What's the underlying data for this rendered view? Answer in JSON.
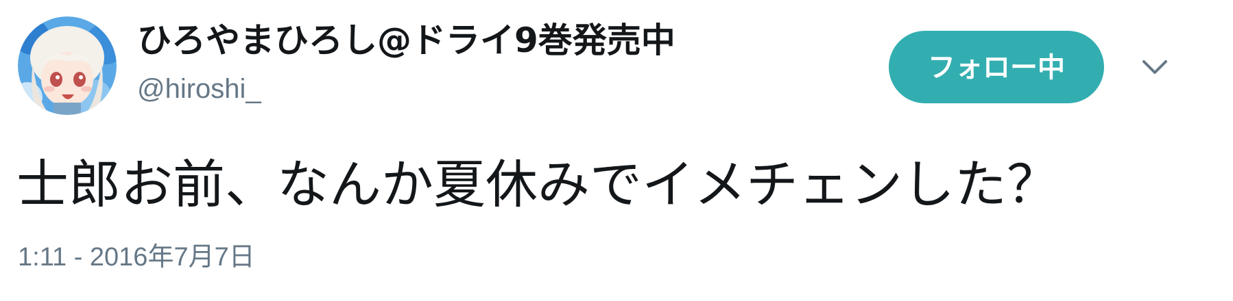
{
  "tweet": {
    "author": {
      "display_name": "ひろやまひろし@ドライ9巻発売中",
      "screen_name": "@hiroshi_",
      "avatar": "anime-character-avatar"
    },
    "follow_button_label": "フォロー中",
    "menu_icon": "chevron-down-icon",
    "text": "士郎お前、なんか夏休みでイメチェンした？",
    "timestamp": "1:11 - 2016年7月7日"
  },
  "colors": {
    "accent": "#33aeb0",
    "text_primary": "#14171a",
    "text_secondary": "#657786",
    "background": "#ffffff"
  }
}
